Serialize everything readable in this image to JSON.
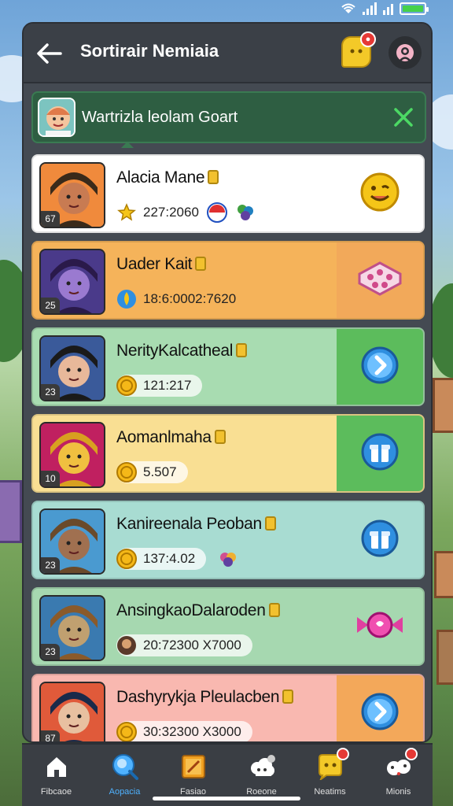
{
  "header": {
    "title": "Sortirair Nemiaia"
  },
  "banner": {
    "text": "Wartrizla leolam Goart"
  },
  "players": [
    {
      "name": "Alacia Mane",
      "stat": "227:2060",
      "level": "67",
      "bg": "#ffffff",
      "action_bg": "#ffffff",
      "action_icon": "smiley-icon",
      "stat_icon": "star-icon"
    },
    {
      "name": "Uader Kait",
      "stat": "18:6:0002:7620",
      "level": "25",
      "bg": "#f5b35a",
      "action_bg": "#f2a95a",
      "action_icon": "dice-icon",
      "stat_icon": "flame-icon"
    },
    {
      "name": "NerityKalcatheal",
      "stat": "121:217",
      "level": "23",
      "bg": "#a8dcb1",
      "action_bg": "#5cbc5c",
      "action_icon": "arrow-right-icon",
      "stat_icon": "coin-icon"
    },
    {
      "name": "Aomanlmaha",
      "stat": "5.507",
      "level": "10",
      "bg": "#f9df93",
      "action_bg": "#5cbc5c",
      "action_icon": "gift-icon",
      "stat_icon": "coin-icon"
    },
    {
      "name": "Kanireenala Peoban",
      "stat": "137:4.02",
      "level": "23",
      "bg": "#a8dcd2",
      "action_bg": "#a8dcd2",
      "action_icon": "gift-icon",
      "stat_icon": "coin-icon"
    },
    {
      "name": "AnsingkaoDalaroden",
      "stat": "20:72300 X7000",
      "level": "23",
      "bg": "#a6d8b0",
      "action_bg": "#a6d8b0",
      "action_icon": "candy-icon",
      "stat_icon": "avatar-icon"
    },
    {
      "name": "Dashyrykja Pleulacben",
      "stat": "30:32300 X3000",
      "level": "87",
      "bg": "#f9b8b0",
      "action_bg": "#f3a85a",
      "action_icon": "arrow-right-icon",
      "stat_icon": "coin-icon"
    }
  ],
  "nav": [
    {
      "label": "Fibcaoe",
      "icon": "home-icon",
      "active": false,
      "badge": false
    },
    {
      "label": "Aopacia",
      "icon": "search-icon",
      "active": true,
      "badge": false
    },
    {
      "label": "Fasiao",
      "icon": "notebook-icon",
      "active": false,
      "badge": false
    },
    {
      "label": "Roeone",
      "icon": "cloud-icon",
      "active": false,
      "badge": false
    },
    {
      "label": "Neatims",
      "icon": "chat-icon",
      "active": false,
      "badge": true
    },
    {
      "label": "Mionis",
      "icon": "group-icon",
      "active": false,
      "badge": true
    }
  ],
  "colors": {
    "accent": "#4fb2ff",
    "panel": "#444a52",
    "badge": "#e53935"
  }
}
